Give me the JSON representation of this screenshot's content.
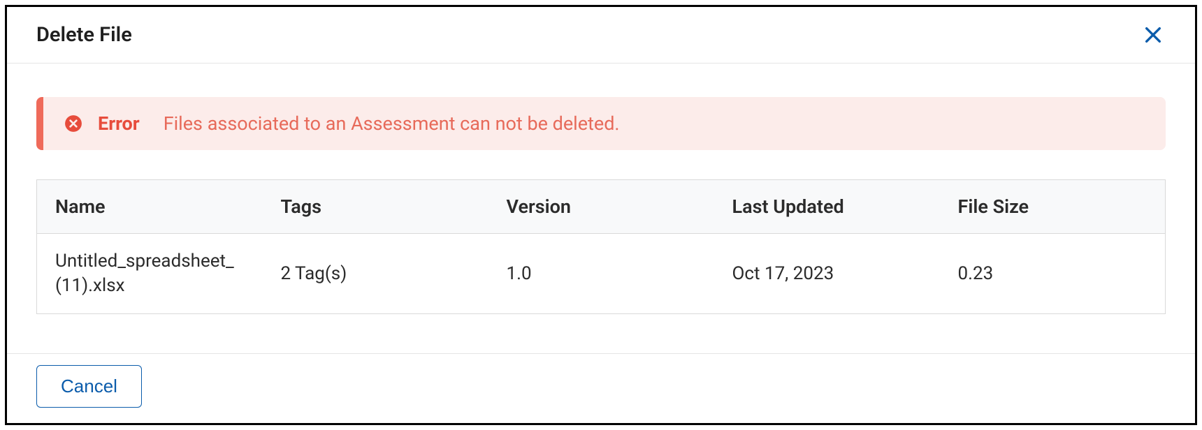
{
  "modal": {
    "title": "Delete File"
  },
  "alert": {
    "title": "Error",
    "message": "Files associated to an Assessment can not be deleted."
  },
  "table": {
    "headers": {
      "name": "Name",
      "tags": "Tags",
      "version": "Version",
      "last_updated": "Last Updated",
      "file_size": "File Size"
    },
    "rows": [
      {
        "name": "Untitled_spreadsheet_(11).xlsx",
        "tags": "2 Tag(s)",
        "version": "1.0",
        "last_updated": "Oct 17, 2023",
        "file_size": "0.23"
      }
    ]
  },
  "footer": {
    "cancel_label": "Cancel"
  }
}
